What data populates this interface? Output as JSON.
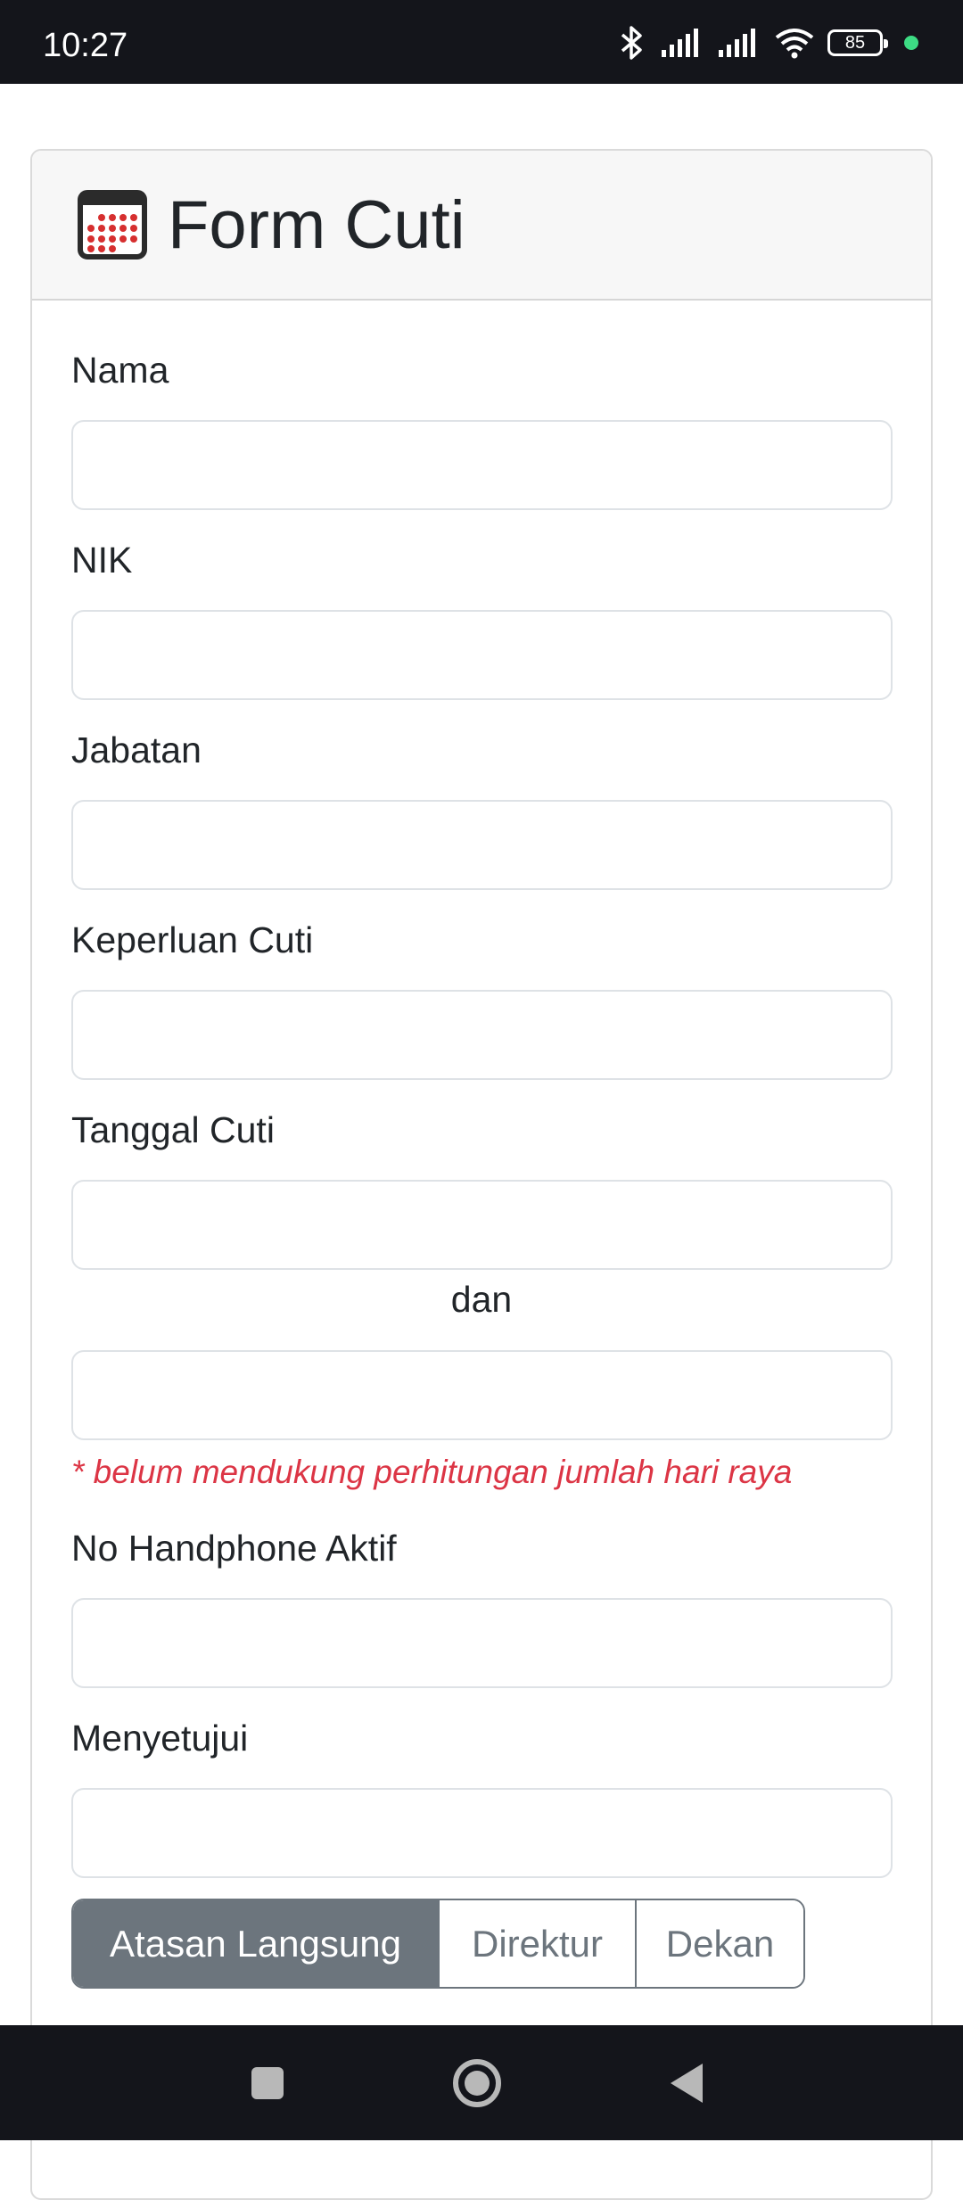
{
  "status_bar": {
    "time": "10:27",
    "battery": "85",
    "icons": [
      "bluetooth-icon",
      "signal-icon",
      "signal-icon",
      "wifi-icon",
      "battery-icon"
    ]
  },
  "form": {
    "title": "Form Cuti",
    "icon": "calendar-icon",
    "fields": {
      "nama": {
        "label": "Nama",
        "value": ""
      },
      "nik": {
        "label": "NIK",
        "value": ""
      },
      "jabatan": {
        "label": "Jabatan",
        "value": ""
      },
      "keperluan": {
        "label": "Keperluan Cuti",
        "value": ""
      },
      "tanggal": {
        "label": "Tanggal Cuti",
        "start": "",
        "separator": "dan",
        "end": "",
        "note": "* belum mendukung perhitungan jumlah hari raya"
      },
      "handphone": {
        "label": "No Handphone Aktif",
        "value": ""
      },
      "menyetujui": {
        "label": "Menyetujui",
        "value": ""
      }
    },
    "approver_options": [
      "Atasan Langsung",
      "Direktur",
      "Dekan"
    ],
    "approver_selected": "Atasan Langsung"
  },
  "colors": {
    "accent": "#6c757d",
    "note": "#dc3545",
    "calendar_dots": "#d62f2f",
    "system_bar": "#14151b"
  },
  "nav_bar": [
    "recents-icon",
    "home-icon",
    "back-icon"
  ]
}
